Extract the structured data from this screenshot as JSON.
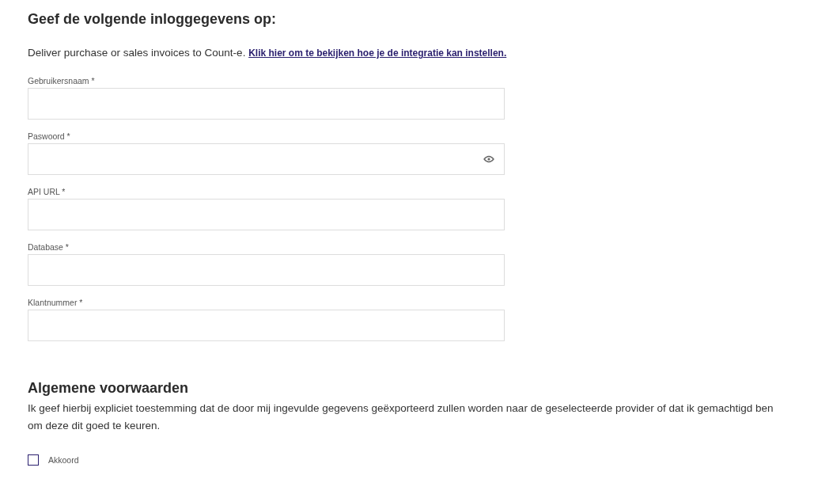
{
  "heading": "Geef de volgende inloggegevens op:",
  "intro": {
    "text": "Deliver purchase or sales invoices to Count-e.",
    "link": "Klik hier om te bekijken hoe je de integratie kan instellen."
  },
  "fields": [
    {
      "label": "Gebruikersnaam *",
      "kind": "text"
    },
    {
      "label": "Paswoord *",
      "kind": "password"
    },
    {
      "label": "API URL *",
      "kind": "text"
    },
    {
      "label": "Database *",
      "kind": "text"
    },
    {
      "label": "Klantnummer *",
      "kind": "text"
    }
  ],
  "terms": {
    "title": "Algemene voorwaarden",
    "text": "Ik geef hierbij expliciet toestemming dat de door mij ingevulde gegevens geëxporteerd zullen worden naar de geselecteerde provider of dat ik gemachtigd ben om deze dit goed te keuren.",
    "checkbox": {
      "label": "Akkoord",
      "checked": false
    }
  }
}
